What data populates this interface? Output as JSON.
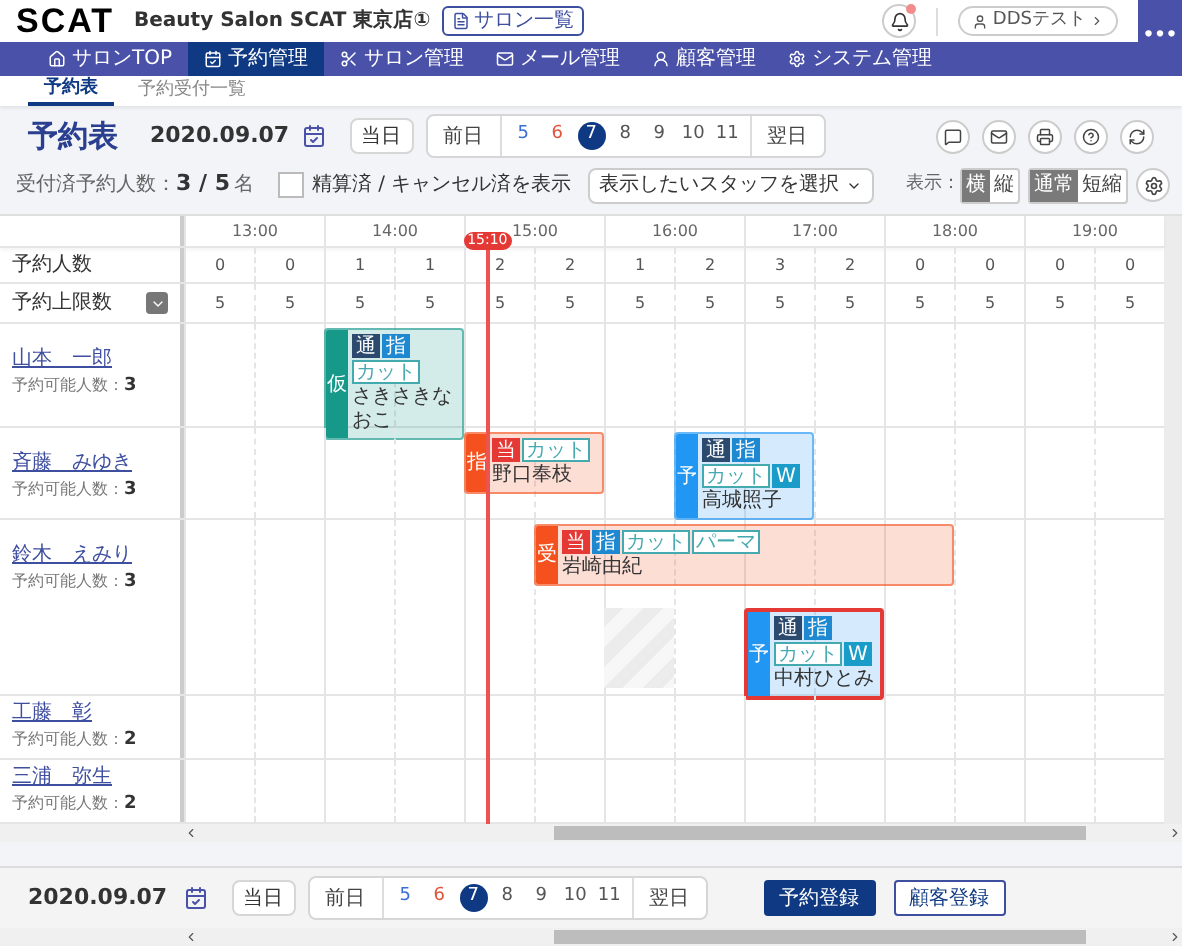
{
  "header": {
    "logo": "SCAT",
    "salon_name": "Beauty Salon SCAT 東京店①",
    "salon_list_button": "サロン一覧",
    "notification_badge": true,
    "user_button": "DDSテスト",
    "more_button": "•••"
  },
  "nav": [
    {
      "label": "サロンTOP",
      "selected": false
    },
    {
      "label": "予約管理",
      "selected": true
    },
    {
      "label": "サロン管理",
      "selected": false
    },
    {
      "label": "メール管理",
      "selected": false
    },
    {
      "label": "顧客管理",
      "selected": false
    },
    {
      "label": "システム管理",
      "selected": false
    }
  ],
  "subtabs": [
    {
      "label": "予約表",
      "selected": true
    },
    {
      "label": "予約受付一覧",
      "selected": false
    }
  ],
  "toolbar": {
    "title": "予約表",
    "date": "2020.09.07",
    "today_button": "当日",
    "prev_button": "前日",
    "next_button": "翌日",
    "days": [
      {
        "label": "5",
        "color": "#3b6fd6",
        "selected": false
      },
      {
        "label": "6",
        "color": "#e0533d",
        "selected": false
      },
      {
        "label": "7",
        "selected": true
      },
      {
        "label": "8",
        "color": "#555555",
        "selected": false
      },
      {
        "label": "9",
        "color": "#555555",
        "selected": false
      },
      {
        "label": "10",
        "color": "#555555",
        "selected": false
      },
      {
        "label": "11",
        "color": "#555555",
        "selected": false
      }
    ],
    "received_label": "受付済予約人数：",
    "received_value": "3 / 5",
    "received_unit": "名",
    "show_settled": {
      "label": "精算済 / キャンセル済を表示",
      "checked": false
    },
    "staff_select": {
      "placeholder": "表示したいスタッフを選択"
    },
    "display_label": "表示：",
    "orientation": [
      {
        "label": "横",
        "selected": true
      },
      {
        "label": "縦",
        "selected": false
      }
    ],
    "mode": [
      {
        "label": "通常",
        "selected": true
      },
      {
        "label": "短縮",
        "selected": false
      }
    ]
  },
  "schedule": {
    "hours": [
      "13:00",
      "14:00",
      "15:00",
      "16:00",
      "17:00",
      "18:00",
      "19:00"
    ],
    "now_marker": "15:10",
    "count_label": "予約人数",
    "counts": [
      "0",
      "0",
      "1",
      "1",
      "2",
      "2",
      "1",
      "2",
      "3",
      "2",
      "0",
      "0",
      "0",
      "0"
    ],
    "limit_label": "予約上限数",
    "limits": [
      "5",
      "5",
      "5",
      "5",
      "5",
      "5",
      "5",
      "5",
      "5",
      "5",
      "5",
      "5",
      "5",
      "5"
    ],
    "staff": [
      {
        "name": "山本　一郎",
        "capacity_label": "予約可能人数：",
        "capacity": "3",
        "appointments": [
          {
            "status": "仮",
            "color": "#17998a",
            "selected": false,
            "customer": "さきさきなおこ",
            "tags": [
              {
                "label": "通",
                "kind": "filled",
                "color": "#2c4a6e"
              },
              {
                "label": "指",
                "kind": "filled",
                "color": "#1e88d0"
              },
              {
                "label": "カット",
                "kind": "outline",
                "color": "#45aab0"
              }
            ]
          }
        ]
      },
      {
        "name": "斉藤　みゆき",
        "capacity_label": "予約可能人数：",
        "capacity": "3",
        "appointments": [
          {
            "status": "指",
            "color": "#f4511e",
            "selected": false,
            "customer": "野口奉枝",
            "tags": [
              {
                "label": "当",
                "kind": "filled",
                "color": "#e53935"
              },
              {
                "label": "カット",
                "kind": "outline",
                "color": "#45aab0"
              }
            ]
          },
          {
            "status": "予",
            "color": "#2196f3",
            "selected": false,
            "customer": "高城照子",
            "tags": [
              {
                "label": "通",
                "kind": "filled",
                "color": "#2c4a6e"
              },
              {
                "label": "指",
                "kind": "filled",
                "color": "#1e88d0"
              },
              {
                "label": "カット",
                "kind": "outline",
                "color": "#45aab0"
              },
              {
                "label": "W",
                "kind": "filled",
                "color": "#1a9cc9"
              }
            ]
          }
        ]
      },
      {
        "name": "鈴木　えみり",
        "capacity_label": "予約可能人数：",
        "capacity": "3",
        "appointments": [
          {
            "status": "受",
            "color": "#f4511e",
            "selected": false,
            "customer": "岩崎由紀",
            "tags": [
              {
                "label": "当",
                "kind": "filled",
                "color": "#e53935"
              },
              {
                "label": "指",
                "kind": "filled",
                "color": "#1e88d0"
              },
              {
                "label": "カット",
                "kind": "outline",
                "color": "#45aab0"
              },
              {
                "label": "パーマ",
                "kind": "outline",
                "color": "#45aab0"
              }
            ]
          },
          {
            "status": "予",
            "color": "#2196f3",
            "selected": true,
            "customer": "中村ひとみ",
            "tags": [
              {
                "label": "通",
                "kind": "filled",
                "color": "#2c4a6e"
              },
              {
                "label": "指",
                "kind": "filled",
                "color": "#1e88d0"
              },
              {
                "label": "カット",
                "kind": "outline",
                "color": "#45aab0"
              },
              {
                "label": "W",
                "kind": "filled",
                "color": "#1a9cc9"
              }
            ]
          }
        ]
      },
      {
        "name": "工藤　彰",
        "capacity_label": "予約可能人数：",
        "capacity": "2"
      },
      {
        "name": "三浦　弥生",
        "capacity_label": "予約可能人数：",
        "capacity": "2"
      }
    ]
  },
  "footer": {
    "date": "2020.09.07",
    "today_button": "当日",
    "prev_button": "前日",
    "next_button": "翌日",
    "days": [
      {
        "label": "5",
        "color": "#3b6fd6",
        "selected": false
      },
      {
        "label": "6",
        "color": "#e0533d",
        "selected": false
      },
      {
        "label": "7",
        "selected": true
      },
      {
        "label": "8",
        "color": "#555555",
        "selected": false
      },
      {
        "label": "9",
        "color": "#555555",
        "selected": false
      },
      {
        "label": "10",
        "color": "#555555",
        "selected": false
      },
      {
        "label": "11",
        "color": "#555555",
        "selected": false
      }
    ],
    "register_button": "予約登録",
    "customer_button": "顧客登録"
  }
}
